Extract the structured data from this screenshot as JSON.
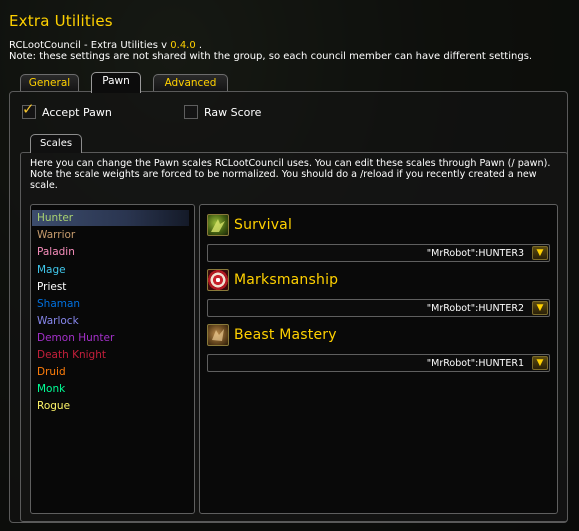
{
  "window": {
    "title": "Extra Utilities",
    "addon_name": "RCLootCouncil - Extra Utilities v",
    "version": "0.4.0",
    "version_suffix": " .",
    "note": "Note: these settings are not shared with the group, so each council member can have different settings."
  },
  "tabs": [
    {
      "label": "General",
      "active": false
    },
    {
      "label": "Pawn",
      "active": true
    },
    {
      "label": "Advanced",
      "active": false
    }
  ],
  "options": {
    "accept_pawn": {
      "label": "Accept Pawn",
      "checked": true
    },
    "raw_score": {
      "label": "Raw Score",
      "checked": false
    }
  },
  "subtab": {
    "label": "Scales"
  },
  "description": "Here you can change the Pawn scales RCLootCouncil uses. You can edit these scales through Pawn (/ pawn). Note the scale weights are forced to be normalized. You should do a /reload if you recently created a new scale.",
  "classes": [
    {
      "name": "Hunter",
      "color": "#a9d271",
      "selected": true
    },
    {
      "name": "Warrior",
      "color": "#c79c6e"
    },
    {
      "name": "Paladin",
      "color": "#f58cba"
    },
    {
      "name": "Mage",
      "color": "#40c7eb"
    },
    {
      "name": "Priest",
      "color": "#ffffff"
    },
    {
      "name": "Shaman",
      "color": "#0070de"
    },
    {
      "name": "Warlock",
      "color": "#8787ed"
    },
    {
      "name": "Demon Hunter",
      "color": "#a330c9"
    },
    {
      "name": "Death Knight",
      "color": "#c41f3b"
    },
    {
      "name": "Druid",
      "color": "#ff7d0a"
    },
    {
      "name": "Monk",
      "color": "#00ff96"
    },
    {
      "name": "Rogue",
      "color": "#fff569"
    }
  ],
  "specs": [
    {
      "name": "Survival",
      "icon": "survival-spec-icon",
      "scale": "\"MrRobot\":HUNTER3"
    },
    {
      "name": "Marksmanship",
      "icon": "marksmanship-spec-icon",
      "scale": "\"MrRobot\":HUNTER2"
    },
    {
      "name": "Beast Mastery",
      "icon": "beast-mastery-spec-icon",
      "scale": "\"MrRobot\":HUNTER1"
    }
  ],
  "dropdown_arrow_glyph": "▼",
  "checkmark_glyph": "✓"
}
